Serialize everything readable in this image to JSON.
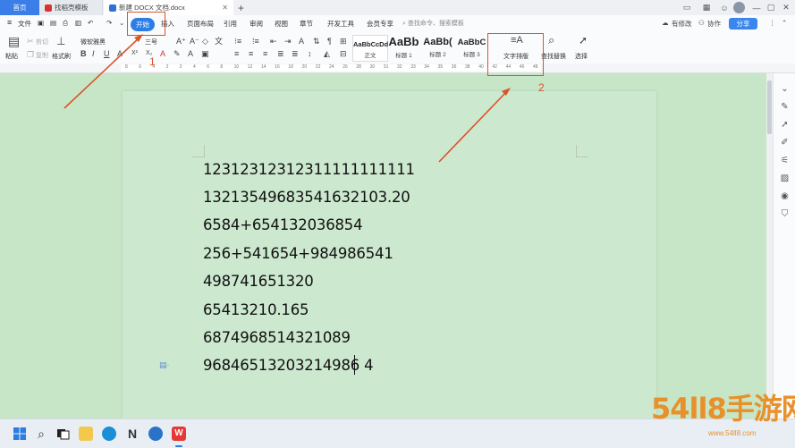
{
  "titlebar": {
    "tabs": [
      {
        "label": "首页"
      },
      {
        "label": "找稻壳模板"
      },
      {
        "label": "新建 DOCX 文档.docx"
      }
    ]
  },
  "menu": {
    "file_label": "文件",
    "items": [
      "开始",
      "插入",
      "页面布局",
      "引用",
      "审阅",
      "视图",
      "章节",
      "开发工具",
      "会员专享"
    ],
    "search_placeholder": "查找命令、搜索模板",
    "right": {
      "unsaved": "有修改",
      "collab": "协作",
      "share": "分享"
    }
  },
  "ribbon": {
    "paste": "粘贴",
    "cut": "剪切",
    "copy": "复制",
    "format_painter": "格式刷",
    "font_name": "微软雅黑",
    "font_size": "三号",
    "styles": [
      {
        "preview": "AaBbCcDd",
        "label": "正文"
      },
      {
        "preview": "AaBb",
        "label": "标题 1"
      },
      {
        "preview": "AaBb(",
        "label": "标题 2"
      },
      {
        "preview": "AaBbC",
        "label": "标题 3"
      }
    ],
    "text_layout": "文字排版",
    "find_replace": "查找替换",
    "select": "选择"
  },
  "ruler": {
    "numbers": [
      "8",
      "6",
      "4",
      "2",
      "2",
      "4",
      "6",
      "8",
      "10",
      "12",
      "14",
      "16",
      "18",
      "20",
      "22",
      "24",
      "26",
      "28",
      "30",
      "31",
      "32",
      "33",
      "34",
      "35",
      "36",
      "38",
      "40",
      "42",
      "44",
      "46",
      "48"
    ]
  },
  "document": {
    "lines": [
      "12312312312311111111111",
      "13213549683541632103.20",
      "6584+654132036854",
      "256+541654+984986541",
      "498741651320",
      "65413210.165",
      "6874968514321089",
      "96846513203214986 4"
    ]
  },
  "annotations": {
    "num1": "1",
    "num2": "2"
  },
  "watermark": {
    "text": "54ll8手游网",
    "url": "www.54ll8.com"
  },
  "colors": {
    "accent": "#2d7de6",
    "page_bg": "#cce8cf",
    "annotation": "#d9552c"
  }
}
